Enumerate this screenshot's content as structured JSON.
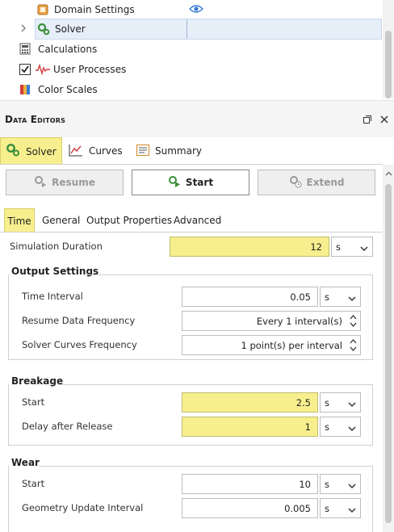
{
  "tree": {
    "items": [
      {
        "label": "Domain Settings",
        "icon": "domain-settings-icon"
      },
      {
        "label": "Solver",
        "icon": "gears-icon"
      },
      {
        "label": "Calculations",
        "icon": "calculator-icon"
      },
      {
        "label": "User Processes",
        "icon": "wave-icon"
      },
      {
        "label": "Color Scales",
        "icon": "color-scales-icon"
      }
    ]
  },
  "panel": {
    "title": "Data Editors"
  },
  "top_tabs": [
    "Solver",
    "Curves",
    "Summary"
  ],
  "actions": {
    "resume": "Resume",
    "start": "Start",
    "extend": "Extend"
  },
  "sub_tabs": [
    "Time",
    "General",
    "Output Properties",
    "Advanced"
  ],
  "simulation_duration": {
    "label": "Simulation Duration",
    "value": "12",
    "unit": "s"
  },
  "output_settings": {
    "title": "Output Settings",
    "time_interval": {
      "label": "Time Interval",
      "value": "0.05",
      "unit": "s"
    },
    "resume_frequency": {
      "label": "Resume Data Frequency",
      "value": "Every 1 interval(s)"
    },
    "curves_frequency": {
      "label": "Solver Curves Frequency",
      "value": "1 point(s) per interval"
    }
  },
  "breakage": {
    "title": "Breakage",
    "start": {
      "label": "Start",
      "value": "2.5",
      "unit": "s"
    },
    "delay": {
      "label": "Delay after Release",
      "value": "1",
      "unit": "s"
    }
  },
  "wear": {
    "title": "Wear",
    "start": {
      "label": "Start",
      "value": "10",
      "unit": "s"
    },
    "geometry_interval": {
      "label": "Geometry Update Interval",
      "value": "0.005",
      "unit": "s"
    }
  },
  "colors": {
    "highlight": "#f7ef8e",
    "accent_green": "#3a8f3a",
    "selection": "#e6eef8"
  }
}
